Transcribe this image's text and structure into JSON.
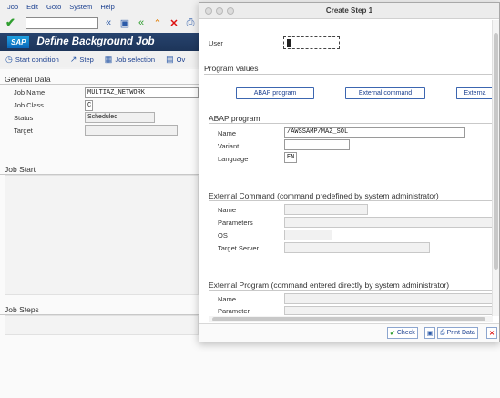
{
  "menu": [
    "Job",
    "Edit",
    "Goto",
    "System",
    "Help"
  ],
  "app": {
    "logo": "SAP",
    "title": "Define Background Job",
    "toolbar": [
      {
        "label": "Start condition",
        "icon": "clock-icon"
      },
      {
        "label": "Step",
        "icon": "step-icon"
      },
      {
        "label": "Job selection",
        "icon": "selection-icon"
      },
      {
        "label": "Ov",
        "icon": "overview-icon"
      }
    ]
  },
  "general": {
    "title": "General Data",
    "fields": [
      {
        "label": "Job Name",
        "value": "MULTIAZ_NETWORK"
      },
      {
        "label": "Job Class",
        "value": "C"
      },
      {
        "label": "Status",
        "value": "Scheduled"
      },
      {
        "label": "Target",
        "value": ""
      }
    ]
  },
  "job_start": {
    "title": "Job Start"
  },
  "job_steps": {
    "title": "Job Steps"
  },
  "dialog": {
    "title": "Create Step  1",
    "user_label": "User",
    "user_value": "",
    "program_values_title": "Program values",
    "buttons": [
      "ABAP program",
      "External command",
      "Externa"
    ],
    "abap": {
      "title": "ABAP program",
      "name_label": "Name",
      "name_value": "/AWSSAMP/MAZ_SOL",
      "variant_label": "Variant",
      "variant_value": "",
      "language_label": "Language",
      "language_value": "EN"
    },
    "ext_command": {
      "title": "External Command (command predefined by system administrator)",
      "labels": [
        "Name",
        "Parameters",
        "OS",
        "Target Server"
      ]
    },
    "ext_program": {
      "title": "External Program (command entered directly by system administrator)",
      "labels": [
        "Name",
        "Parameter"
      ]
    },
    "footer": {
      "check": "Check",
      "print": "Print Data"
    }
  },
  "colors": {
    "title_bar": "#1d355a",
    "accent": "#1a3f8f",
    "ok_green": "#2f9e2f",
    "cancel_red": "#dd1111"
  }
}
